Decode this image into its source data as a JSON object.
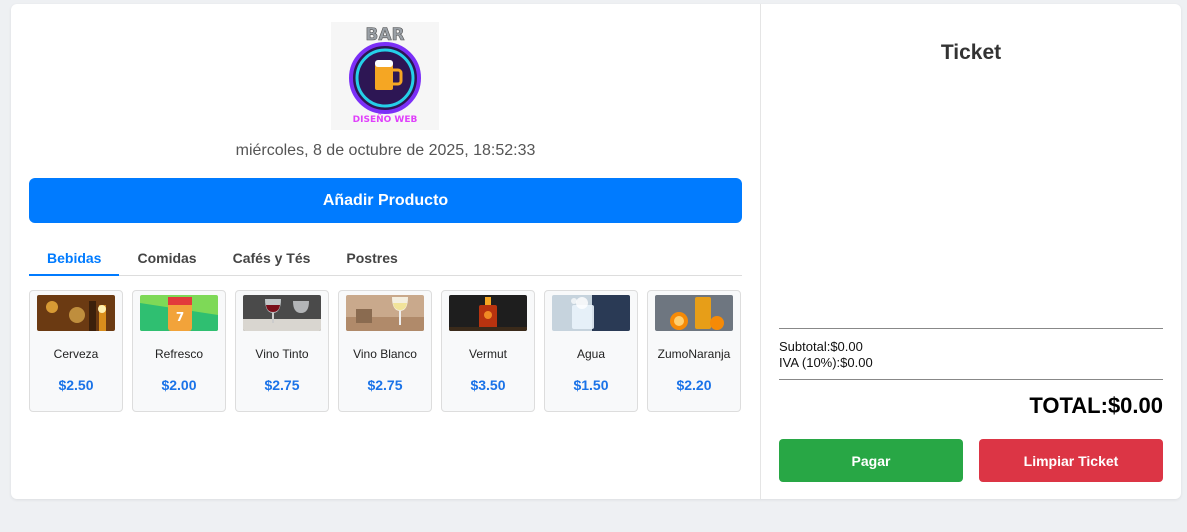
{
  "header": {
    "logo": {
      "title": "BAR",
      "subtitle": "DISEÑO WEB",
      "icon": "beer-icon"
    },
    "datetime": "miércoles, 8 de octubre de 2025, 18:52:33"
  },
  "actions": {
    "add_product_label": "Añadir Producto"
  },
  "tabs": [
    {
      "label": "Bebidas",
      "active": true
    },
    {
      "label": "Comidas",
      "active": false
    },
    {
      "label": "Cafés y Tés",
      "active": false
    },
    {
      "label": "Postres",
      "active": false
    }
  ],
  "products": [
    {
      "name": "Cerveza",
      "price": "$2.50",
      "icon": "beer-bottles-image"
    },
    {
      "name": "Refresco",
      "price": "$2.00",
      "icon": "soda-can-image"
    },
    {
      "name": "Vino Tinto",
      "price": "$2.75",
      "icon": "red-wine-image"
    },
    {
      "name": "Vino Blanco",
      "price": "$2.75",
      "icon": "white-wine-image"
    },
    {
      "name": "Vermut",
      "price": "$3.50",
      "icon": "vermouth-image"
    },
    {
      "name": "Agua",
      "price": "$1.50",
      "icon": "water-image"
    },
    {
      "name": "ZumoNaranja",
      "price": "$2.20",
      "icon": "orange-juice-image"
    }
  ],
  "ticket": {
    "title": "Ticket",
    "subtotal_line": "Subtotal:$0.00",
    "iva_line": "IVA (10%):$0.00",
    "total_line": "TOTAL:$0.00",
    "pay_label": "Pagar",
    "clear_label": "Limpiar Ticket"
  },
  "colors": {
    "primary": "#007bff",
    "pay": "#28a745",
    "clear": "#dc3545",
    "price": "#1a73e8"
  }
}
